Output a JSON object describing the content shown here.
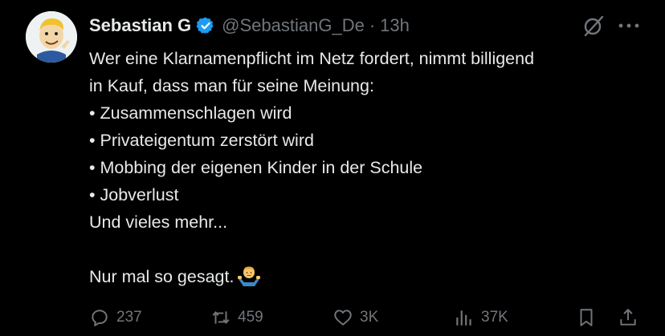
{
  "tweet": {
    "author_name": "Sebastian G",
    "handle": "@SebastianG_De",
    "separator": "·",
    "time": "13h",
    "lines": [
      "Wer eine Klarnamenpflicht im Netz fordert, nimmt billigend",
      "in Kauf, dass man für seine Meinung:",
      "• Zusammenschlagen wird",
      "• Privateigentum zerstört wird",
      "• Mobbing der eigenen Kinder in der Schule",
      "• Jobverlust",
      "Und vieles mehr..."
    ],
    "closing_line": "Nur mal so gesagt."
  },
  "actions": {
    "replies": "237",
    "reposts": "459",
    "likes": "3K",
    "views": "37K"
  },
  "colors": {
    "background": "#000000",
    "text": "#e7e9ea",
    "secondary": "#71767b",
    "verified": "#1d9bf0"
  },
  "icons": [
    "avatar",
    "verified-badge-icon",
    "grok-icon",
    "more-icon",
    "reply-icon",
    "repost-icon",
    "like-icon",
    "views-icon",
    "bookmark-icon",
    "share-icon",
    "person-shrugging-emoji"
  ]
}
